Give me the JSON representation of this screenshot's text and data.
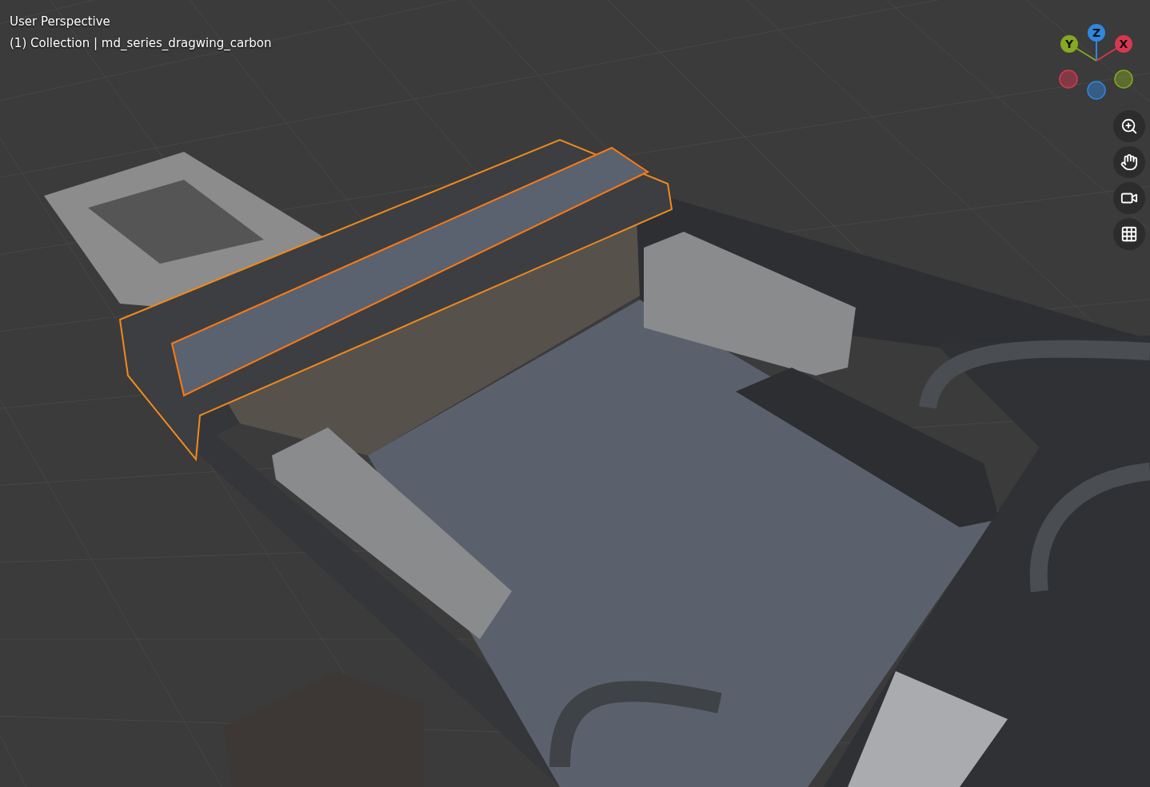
{
  "viewport": {
    "info_lines": [
      "User Perspective",
      "(1) Collection | md_series_dragwing_carbon"
    ]
  },
  "gizmo": {
    "axes": [
      {
        "label": "Z",
        "color": "#2f87e0"
      },
      {
        "label": "Y",
        "color": "#86a822"
      },
      {
        "label": "X",
        "color": "#d8384f"
      }
    ]
  }
}
